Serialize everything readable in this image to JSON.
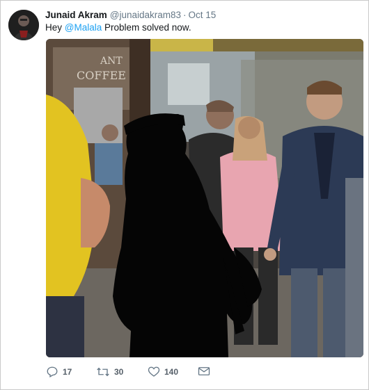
{
  "tweet": {
    "author_name": "Junaid Akram",
    "author_handle": "@junaidakram83",
    "separator": "·",
    "date": "Oct 15",
    "text_before": "Hey ",
    "mention": "@Malala",
    "text_after": " Problem solved now.",
    "photo_sign_lines": [
      "ANT",
      "COFFEE"
    ]
  },
  "actions": {
    "reply_count": "17",
    "retweet_count": "30",
    "like_count": "140"
  },
  "icons": {
    "reply": "reply-icon",
    "retweet": "retweet-icon",
    "like": "heart-icon",
    "message": "envelope-icon"
  },
  "colors": {
    "link": "#1da1f2",
    "muted": "#657786"
  }
}
